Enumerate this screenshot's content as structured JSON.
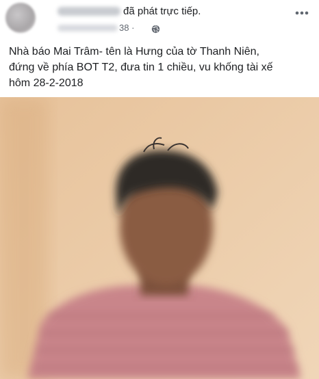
{
  "header": {
    "action_text": "đã phát trực tiếp.",
    "time_text": "38 ·",
    "privacy_icon": "globe-icon",
    "more_icon": "more-options-icon"
  },
  "caption": {
    "lines": [
      "Nhà báo Mai Trâm- tên là Hưng của tờ Thanh Niên,",
      "đứng về phía BOT T2, đưa tin 1 chiều, vu khống tài xế",
      "hôm 28-2-2018"
    ]
  },
  "video": {
    "colors": {
      "wall": "#eac9a4",
      "hair": "#2e2a28",
      "face": "#8a5b42",
      "shirt": "#c9858a"
    }
  }
}
